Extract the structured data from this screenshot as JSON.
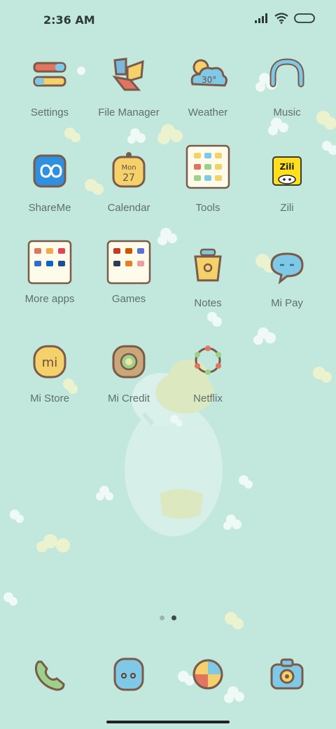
{
  "status": {
    "time": "2:36 AM"
  },
  "apps": [
    {
      "label": "Settings",
      "icon": "settings-icon"
    },
    {
      "label": "File Manager",
      "icon": "file-manager-icon"
    },
    {
      "label": "Weather",
      "icon": "weather-icon",
      "badge": "30°"
    },
    {
      "label": "Music",
      "icon": "music-icon"
    },
    {
      "label": "ShareMe",
      "icon": "shareme-icon"
    },
    {
      "label": "Calendar",
      "icon": "calendar-icon",
      "day": "Mon",
      "date": "27"
    },
    {
      "label": "Tools",
      "icon": "tools-folder-icon"
    },
    {
      "label": "Zili",
      "icon": "zili-icon",
      "brand": "Zili"
    },
    {
      "label": "More apps",
      "icon": "more-apps-folder-icon"
    },
    {
      "label": "Games",
      "icon": "games-folder-icon"
    },
    {
      "label": "Notes",
      "icon": "notes-icon"
    },
    {
      "label": "Mi Pay",
      "icon": "mi-pay-icon"
    },
    {
      "label": "Mi Store",
      "icon": "mi-store-icon",
      "brand": "mi"
    },
    {
      "label": "Mi Credit",
      "icon": "mi-credit-icon"
    },
    {
      "label": "Netflix",
      "icon": "netflix-icon"
    }
  ],
  "dock": [
    {
      "icon": "phone-icon"
    },
    {
      "icon": "messages-icon"
    },
    {
      "icon": "browser-icon"
    },
    {
      "icon": "camera-icon"
    }
  ],
  "pages": {
    "count": 2,
    "active": 1
  }
}
